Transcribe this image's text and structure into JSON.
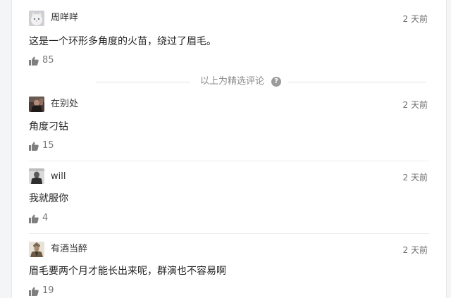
{
  "colors": {
    "text": "#222222",
    "muted": "#7a7a7a",
    "like_icon": "#7f7f7f",
    "page_bg": "#f4f5f6"
  },
  "featured_label": "以上为精选评论",
  "help_icon": "question-mark",
  "comments": [
    {
      "user": "周咩咩",
      "time": "2 天前",
      "text": "这是一个环形多角度的火苗，绕过了眉毛。",
      "likes": "85",
      "avatar": "white-cat"
    },
    {
      "user": "在别处",
      "time": "2 天前",
      "text": "角度刁钻",
      "likes": "15",
      "avatar": "dark-figure"
    },
    {
      "user": "will",
      "time": "2 天前",
      "text": "我就服你",
      "likes": "4",
      "avatar": "person-dark"
    },
    {
      "user": "有酒当醉",
      "time": "2 天前",
      "text": "眉毛要两个月才能长出来呢，群演也不容易啊",
      "likes": "19",
      "avatar": "ancient-warrior"
    }
  ]
}
